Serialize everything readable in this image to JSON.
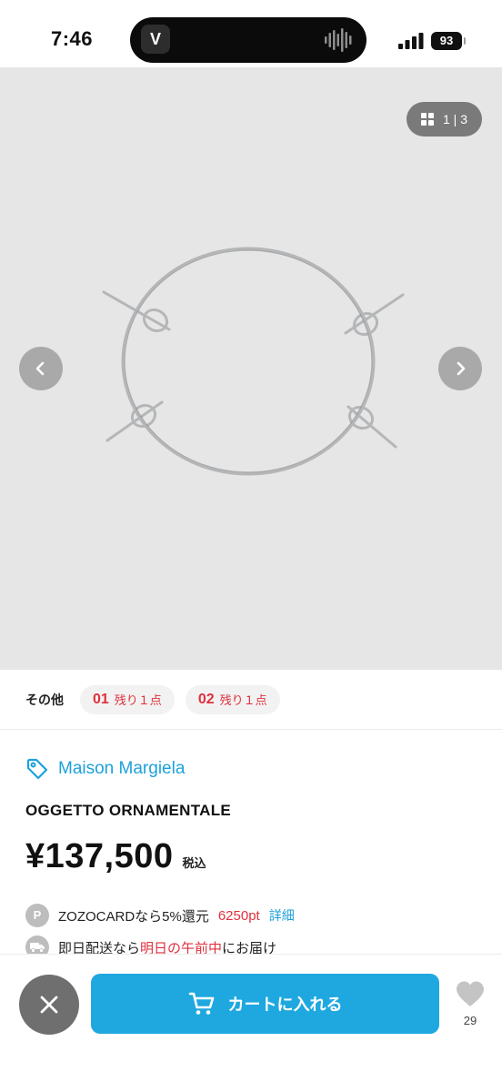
{
  "status_bar": {
    "time": "7:46",
    "island_app_glyph": "V",
    "battery": "93",
    "icons": [
      "signal-icon",
      "battery-icon"
    ]
  },
  "gallery": {
    "counter": "1 | 3",
    "icons": [
      "grid-icon",
      "chevron-left-icon",
      "chevron-right-icon"
    ],
    "background": "#e6e6e6"
  },
  "variations": {
    "label": "その他",
    "chips": [
      {
        "num": "01",
        "stock": "残り１点"
      },
      {
        "num": "02",
        "stock": "残り１点"
      }
    ]
  },
  "product": {
    "brand": "Maison Margiela",
    "title": "OGGETTO ORNAMENTALE",
    "price": "¥137,500",
    "tax_label": "税込"
  },
  "points": {
    "icon_letter": "P",
    "text": "ZOZOCARDなら5%還元",
    "value": "6250pt",
    "link": "詳細"
  },
  "delivery": {
    "text_before": "即日配送なら",
    "highlight": "明日の午前中",
    "text_after": "にお届け"
  },
  "bottom_bar": {
    "cart_label": "カートに入れる",
    "favorite_count": "29"
  },
  "colors": {
    "accent": "#1fa8e0",
    "brand_link": "#1da1dc",
    "stock_red": "#e0303c"
  }
}
